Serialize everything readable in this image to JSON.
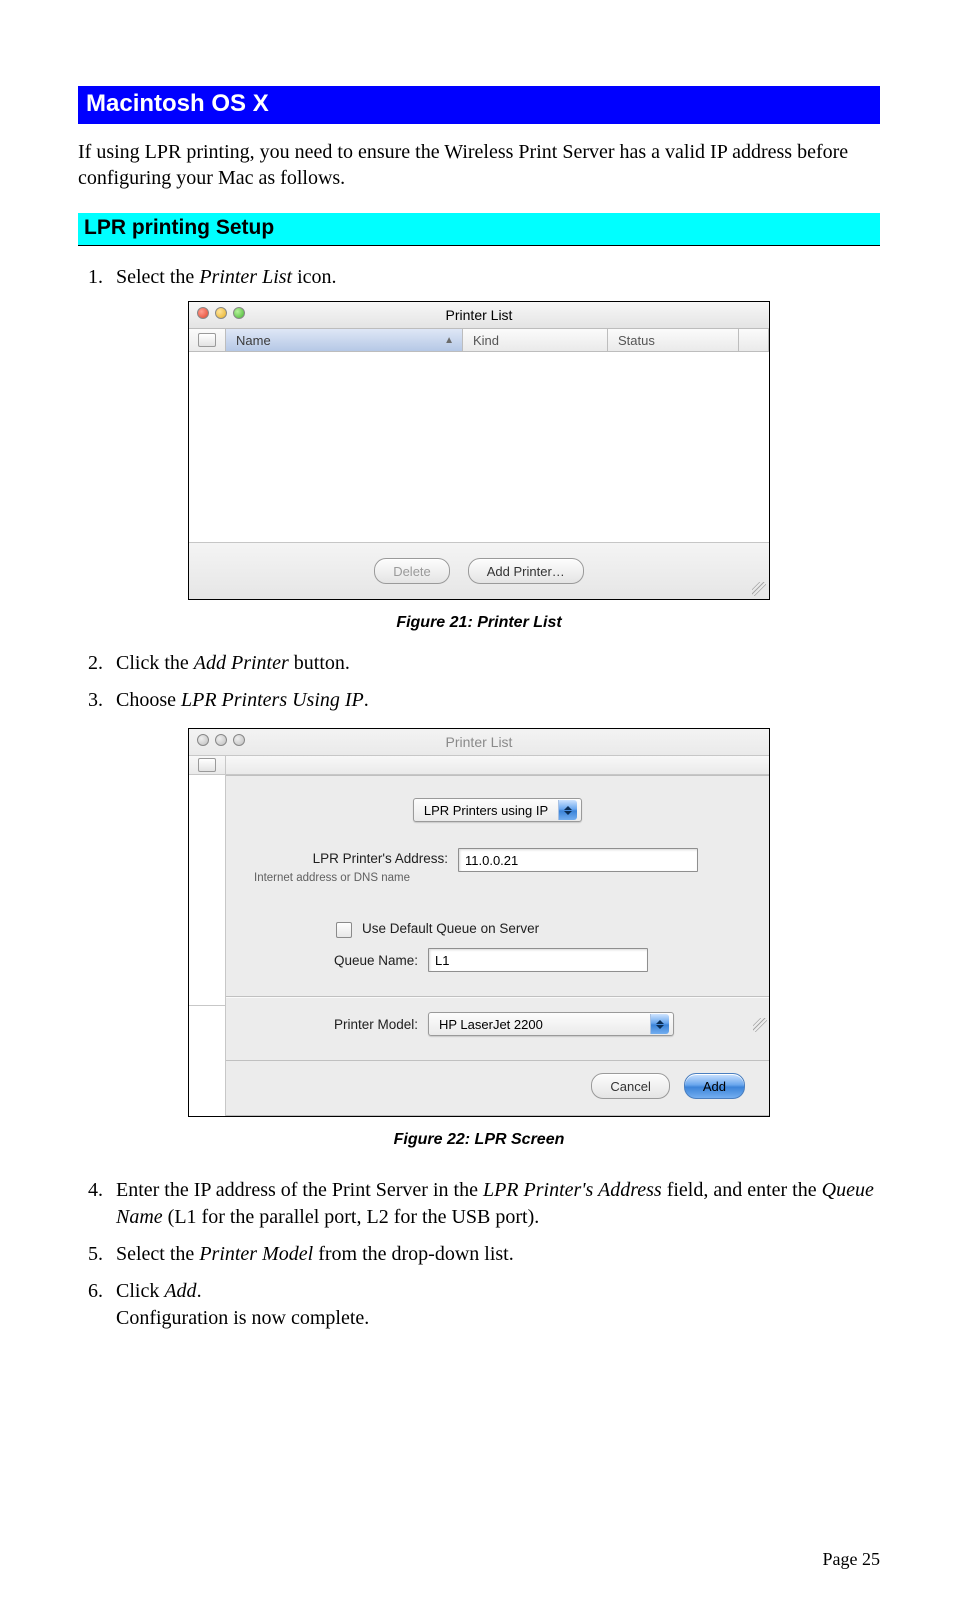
{
  "section_heading": "Macintosh OS X",
  "intro": "If using LPR printing, you need to ensure the Wireless Print Server has a valid IP address before configuring your Mac as follows.",
  "subheading": "LPR printing Setup",
  "steps_a": {
    "s1_pre": "Select the ",
    "s1_em": "Printer List",
    "s1_post": " icon."
  },
  "fig1": {
    "title": "Printer List",
    "col_name": "Name",
    "col_kind": "Kind",
    "col_status": "Status",
    "btn_delete": "Delete",
    "btn_add": "Add Printer…",
    "caption": "Figure 21: Printer List"
  },
  "steps_b": {
    "s2_pre": "Click the ",
    "s2_em": "Add Printer",
    "s2_post": " button.",
    "s3_pre": "Choose ",
    "s3_em": "LPR Printers Using IP",
    "s3_post": "."
  },
  "fig2": {
    "title": "Printer List",
    "popup_protocol": "LPR Printers using IP",
    "addr_label": "LPR Printer's Address:",
    "addr_hint": "Internet address or DNS name",
    "addr_value": "11.0.0.21",
    "default_queue": "Use Default Queue on Server",
    "queue_label": "Queue Name:",
    "queue_value": "L1",
    "model_label": "Printer Model:",
    "model_value": "HP LaserJet 2200",
    "btn_cancel": "Cancel",
    "btn_add": "Add",
    "caption": "Figure 22: LPR Screen"
  },
  "steps_c": {
    "s4_a": "Enter the IP address of the Print Server in the ",
    "s4_em1": "LPR Printer's Address",
    "s4_b": " field, and enter the ",
    "s4_em2": "Queue Name",
    "s4_c": " (L1 for the parallel port, L2 for the USB port).",
    "s5_a": "Select the ",
    "s5_em": "Printer Model",
    "s5_b": " from the drop-down list.",
    "s6_a": "Click ",
    "s6_em": "Add",
    "s6_b": ".",
    "s6_c": "Configuration is now complete."
  },
  "page_num": "Page 25"
}
